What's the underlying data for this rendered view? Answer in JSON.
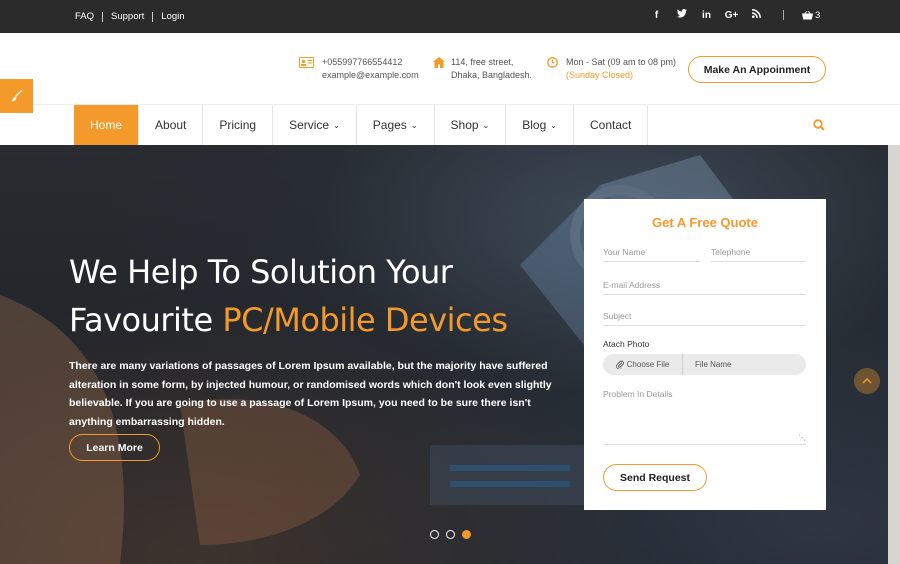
{
  "topbar": {
    "links": [
      "FAQ",
      "Support",
      "Login"
    ],
    "social_icons": [
      "facebook-icon",
      "twitter-icon",
      "linkedin-icon",
      "google-plus-icon",
      "rss-icon"
    ],
    "cart_count": "3"
  },
  "header": {
    "phone": "+055997766554412",
    "email": "example@example.com",
    "address_line1": "114, free street,",
    "address_line2": "Dhaka, Bangladesh.",
    "hours": "Mon - Sat (09 am to 08 pm)",
    "closed_note": "(Sunday Closed)",
    "appointment_label": "Make An Appoinment"
  },
  "nav": {
    "items": [
      {
        "label": "Home",
        "active": true,
        "dropdown": false
      },
      {
        "label": "About",
        "active": false,
        "dropdown": false
      },
      {
        "label": "Pricing",
        "active": false,
        "dropdown": false
      },
      {
        "label": "Service",
        "active": false,
        "dropdown": true
      },
      {
        "label": "Pages",
        "active": false,
        "dropdown": true
      },
      {
        "label": "Shop",
        "active": false,
        "dropdown": true
      },
      {
        "label": "Blog",
        "active": false,
        "dropdown": true
      },
      {
        "label": "Contact",
        "active": false,
        "dropdown": false
      }
    ]
  },
  "hero": {
    "title_line1": "We Help To Solution Your",
    "title_line2_prefix": "Favourite ",
    "title_line2_highlight": "PC/Mobile Devices",
    "description": "There are many variations of passages of Lorem Ipsum available, but the majority have suffered alteration in some form, by injected humour, or randomised words which don't look even slightly believable. If you are going to use a passage of Lorem Ipsum, you need to be sure there isn't anything embarrassing hidden.",
    "cta_label": "Learn More",
    "slides": 3,
    "active_slide": 3
  },
  "quote_form": {
    "title": "Get A Free Quote",
    "name_placeholder": "Your Name",
    "telephone_placeholder": "Telephone",
    "email_placeholder": "E-mail Address",
    "subject_placeholder": "Subject",
    "attach_label": "Atach Photo",
    "choose_file_label": "Choose File",
    "file_name_label": "File Name",
    "details_placeholder": "Problem In Details",
    "submit_label": "Send Request"
  },
  "colors": {
    "accent": "#f39a2b",
    "topbar_bg": "#2b2b2b"
  }
}
